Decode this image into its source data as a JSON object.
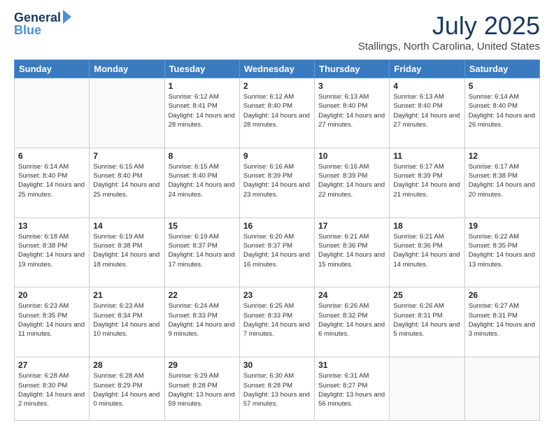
{
  "header": {
    "logo_line1": "General",
    "logo_line2": "Blue",
    "title": "July 2025",
    "location": "Stallings, North Carolina, United States"
  },
  "weekdays": [
    "Sunday",
    "Monday",
    "Tuesday",
    "Wednesday",
    "Thursday",
    "Friday",
    "Saturday"
  ],
  "weeks": [
    [
      {
        "day": "",
        "info": ""
      },
      {
        "day": "",
        "info": ""
      },
      {
        "day": "1",
        "info": "Sunrise: 6:12 AM\nSunset: 8:41 PM\nDaylight: 14 hours and 28 minutes."
      },
      {
        "day": "2",
        "info": "Sunrise: 6:12 AM\nSunset: 8:40 PM\nDaylight: 14 hours and 28 minutes."
      },
      {
        "day": "3",
        "info": "Sunrise: 6:13 AM\nSunset: 8:40 PM\nDaylight: 14 hours and 27 minutes."
      },
      {
        "day": "4",
        "info": "Sunrise: 6:13 AM\nSunset: 8:40 PM\nDaylight: 14 hours and 27 minutes."
      },
      {
        "day": "5",
        "info": "Sunrise: 6:14 AM\nSunset: 8:40 PM\nDaylight: 14 hours and 26 minutes."
      }
    ],
    [
      {
        "day": "6",
        "info": "Sunrise: 6:14 AM\nSunset: 8:40 PM\nDaylight: 14 hours and 25 minutes."
      },
      {
        "day": "7",
        "info": "Sunrise: 6:15 AM\nSunset: 8:40 PM\nDaylight: 14 hours and 25 minutes."
      },
      {
        "day": "8",
        "info": "Sunrise: 6:15 AM\nSunset: 8:40 PM\nDaylight: 14 hours and 24 minutes."
      },
      {
        "day": "9",
        "info": "Sunrise: 6:16 AM\nSunset: 8:39 PM\nDaylight: 14 hours and 23 minutes."
      },
      {
        "day": "10",
        "info": "Sunrise: 6:16 AM\nSunset: 8:39 PM\nDaylight: 14 hours and 22 minutes."
      },
      {
        "day": "11",
        "info": "Sunrise: 6:17 AM\nSunset: 8:39 PM\nDaylight: 14 hours and 21 minutes."
      },
      {
        "day": "12",
        "info": "Sunrise: 6:17 AM\nSunset: 8:38 PM\nDaylight: 14 hours and 20 minutes."
      }
    ],
    [
      {
        "day": "13",
        "info": "Sunrise: 6:18 AM\nSunset: 8:38 PM\nDaylight: 14 hours and 19 minutes."
      },
      {
        "day": "14",
        "info": "Sunrise: 6:19 AM\nSunset: 8:38 PM\nDaylight: 14 hours and 18 minutes."
      },
      {
        "day": "15",
        "info": "Sunrise: 6:19 AM\nSunset: 8:37 PM\nDaylight: 14 hours and 17 minutes."
      },
      {
        "day": "16",
        "info": "Sunrise: 6:20 AM\nSunset: 8:37 PM\nDaylight: 14 hours and 16 minutes."
      },
      {
        "day": "17",
        "info": "Sunrise: 6:21 AM\nSunset: 8:36 PM\nDaylight: 14 hours and 15 minutes."
      },
      {
        "day": "18",
        "info": "Sunrise: 6:21 AM\nSunset: 8:36 PM\nDaylight: 14 hours and 14 minutes."
      },
      {
        "day": "19",
        "info": "Sunrise: 6:22 AM\nSunset: 8:35 PM\nDaylight: 14 hours and 13 minutes."
      }
    ],
    [
      {
        "day": "20",
        "info": "Sunrise: 6:23 AM\nSunset: 8:35 PM\nDaylight: 14 hours and 11 minutes."
      },
      {
        "day": "21",
        "info": "Sunrise: 6:23 AM\nSunset: 8:34 PM\nDaylight: 14 hours and 10 minutes."
      },
      {
        "day": "22",
        "info": "Sunrise: 6:24 AM\nSunset: 8:33 PM\nDaylight: 14 hours and 9 minutes."
      },
      {
        "day": "23",
        "info": "Sunrise: 6:25 AM\nSunset: 8:33 PM\nDaylight: 14 hours and 7 minutes."
      },
      {
        "day": "24",
        "info": "Sunrise: 6:26 AM\nSunset: 8:32 PM\nDaylight: 14 hours and 6 minutes."
      },
      {
        "day": "25",
        "info": "Sunrise: 6:26 AM\nSunset: 8:31 PM\nDaylight: 14 hours and 5 minutes."
      },
      {
        "day": "26",
        "info": "Sunrise: 6:27 AM\nSunset: 8:31 PM\nDaylight: 14 hours and 3 minutes."
      }
    ],
    [
      {
        "day": "27",
        "info": "Sunrise: 6:28 AM\nSunset: 8:30 PM\nDaylight: 14 hours and 2 minutes."
      },
      {
        "day": "28",
        "info": "Sunrise: 6:28 AM\nSunset: 8:29 PM\nDaylight: 14 hours and 0 minutes."
      },
      {
        "day": "29",
        "info": "Sunrise: 6:29 AM\nSunset: 8:28 PM\nDaylight: 13 hours and 59 minutes."
      },
      {
        "day": "30",
        "info": "Sunrise: 6:30 AM\nSunset: 8:28 PM\nDaylight: 13 hours and 57 minutes."
      },
      {
        "day": "31",
        "info": "Sunrise: 6:31 AM\nSunset: 8:27 PM\nDaylight: 13 hours and 56 minutes."
      },
      {
        "day": "",
        "info": ""
      },
      {
        "day": "",
        "info": ""
      }
    ]
  ]
}
